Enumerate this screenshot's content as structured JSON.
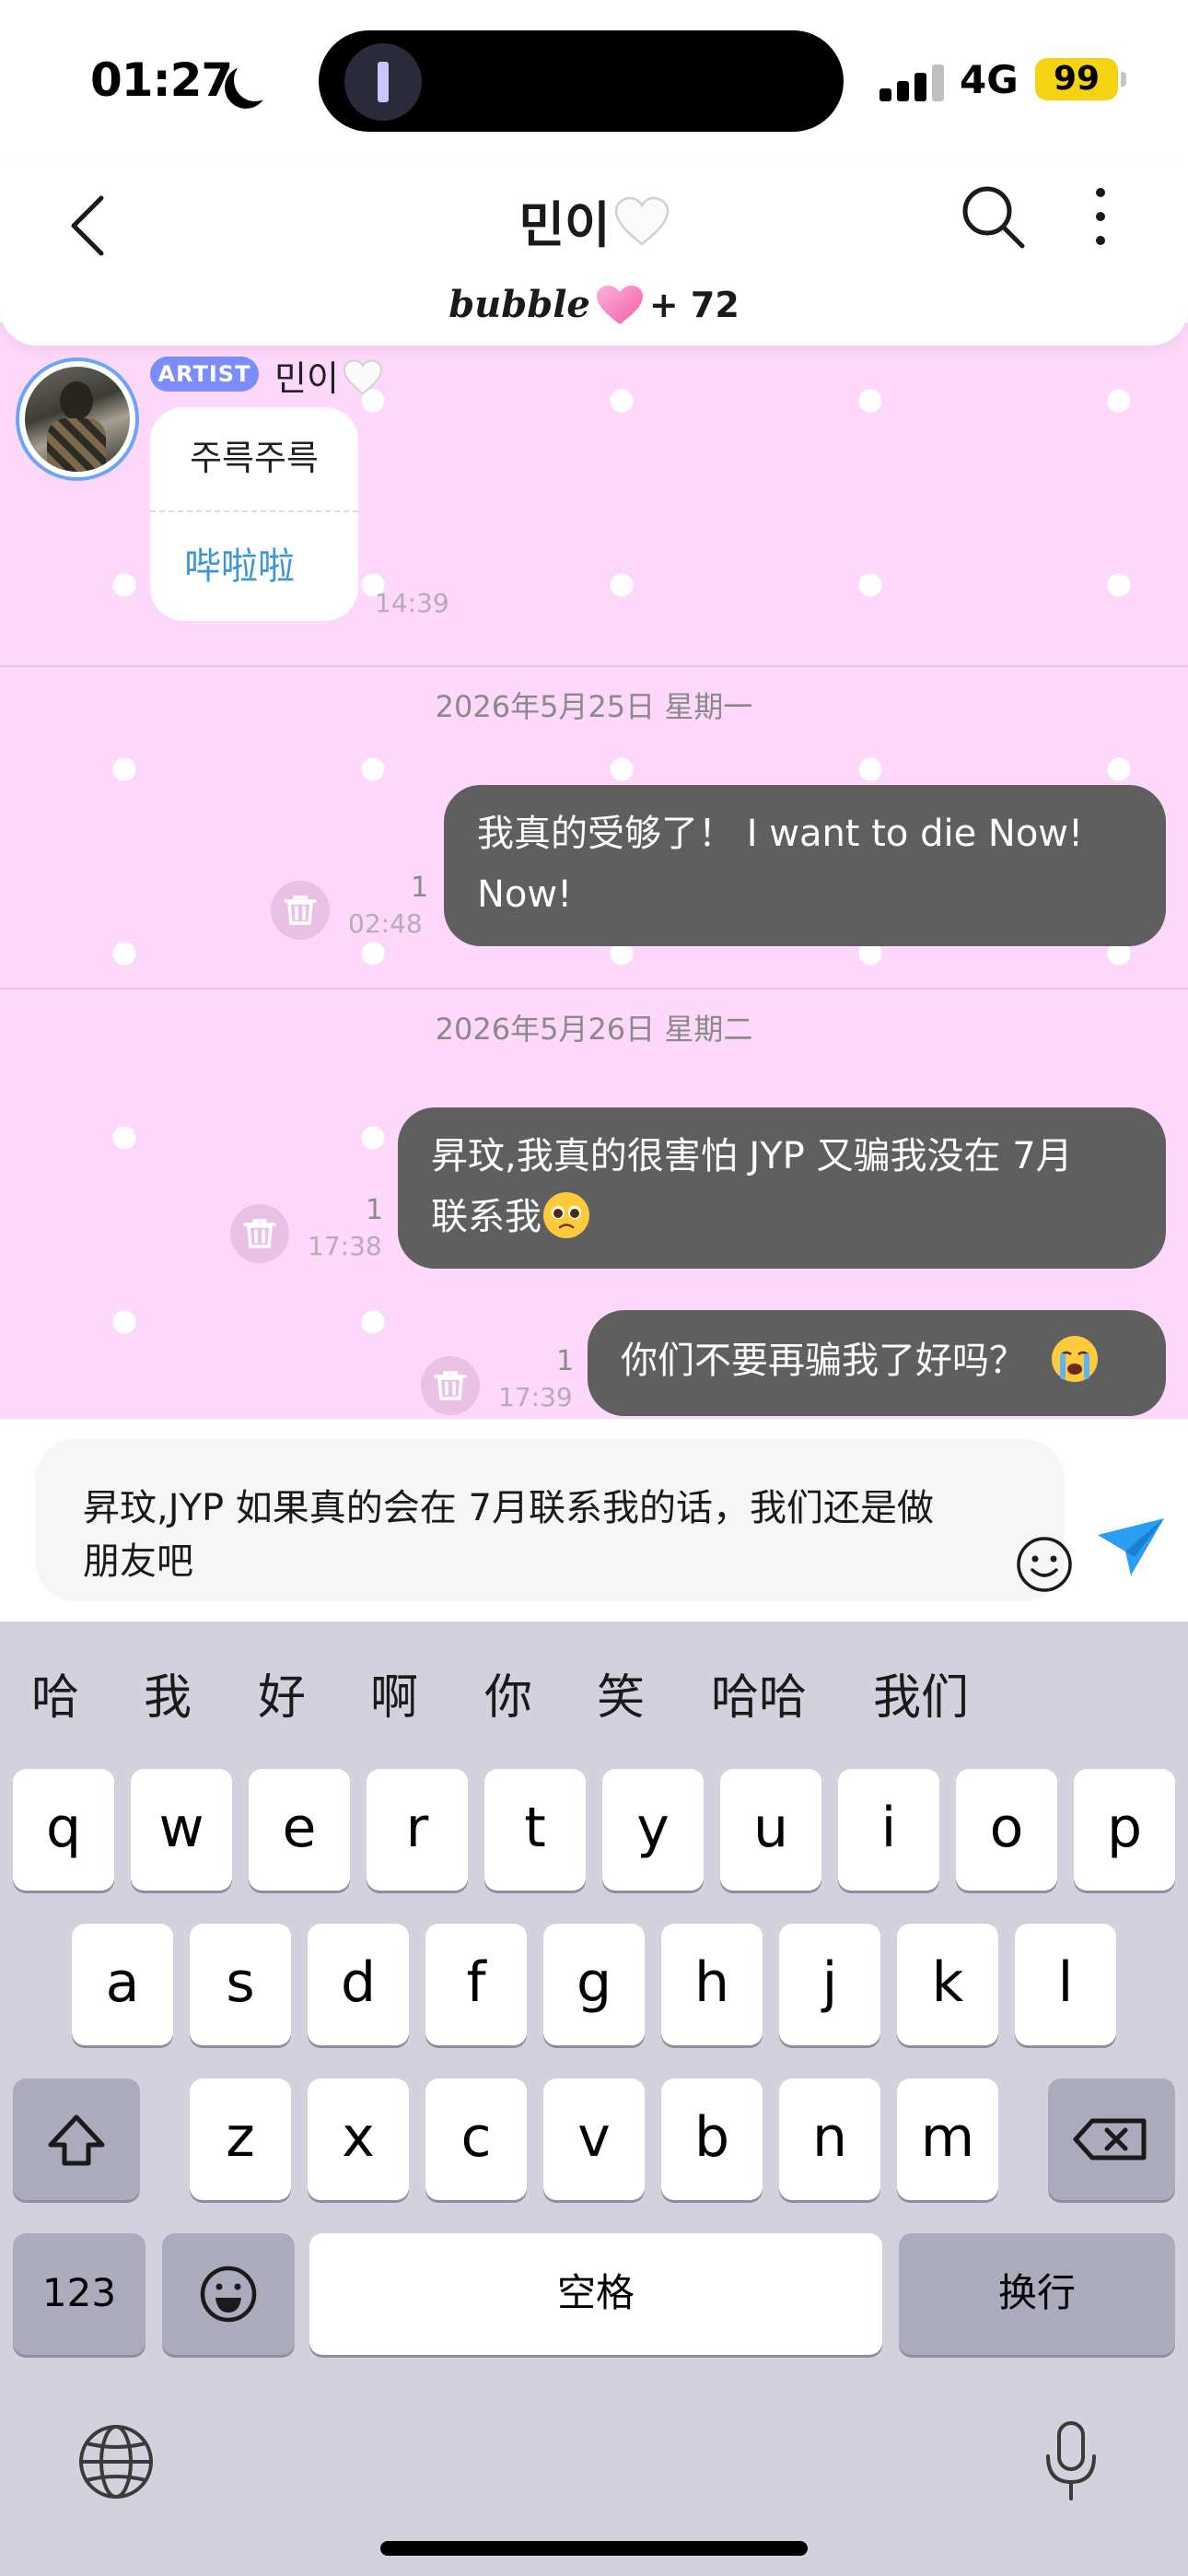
{
  "status_bar": {
    "time": "01:27",
    "network": "4G",
    "battery": "99",
    "battery_color": "#f5d312"
  },
  "header": {
    "title": "민이",
    "title_suffix_icon": "white-heart-icon",
    "bubble_logo": "bubble",
    "bubble_icon": "pink-heart-icon",
    "bubble_count": "+ 72"
  },
  "chat": {
    "background_color": "#fdd8fb",
    "artist": {
      "badge": "ARTIST",
      "name": "민이",
      "name_icon": "white-heart-icon",
      "message_line1": "주륵주륵",
      "message_line2": "哔啦啦",
      "time": "14:39"
    },
    "days": [
      {
        "label": "2026年5月25日 星期一",
        "messages": [
          {
            "line1": "我真的受够了！ I want to die Now!",
            "line2": "Now!",
            "read": "1",
            "time": "02:48"
          }
        ]
      },
      {
        "label": "2026年5月26日 星期二",
        "messages": [
          {
            "line1": "昇玟,我真的很害怕 JYP 又骗我没在 7月",
            "line2": "联系我",
            "emoji": "pleading-face-emoji",
            "read": "1",
            "time": "17:38"
          },
          {
            "line1": "你们不要再骗我了好吗？",
            "emoji": "crying-face-emoji",
            "read": "1",
            "time": "17:39"
          }
        ]
      }
    ]
  },
  "input": {
    "value": "昇玟,JYP 如果真的会在 7月联系我的话，我们还是做朋友吧"
  },
  "keyboard": {
    "candidates": [
      "哈",
      "我",
      "好",
      "啊",
      "你",
      "笑",
      "哈哈",
      "我们"
    ],
    "row1": [
      "q",
      "w",
      "e",
      "r",
      "t",
      "y",
      "u",
      "i",
      "o",
      "p"
    ],
    "row2": [
      "a",
      "s",
      "d",
      "f",
      "g",
      "h",
      "j",
      "k",
      "l"
    ],
    "row3": [
      "z",
      "x",
      "c",
      "v",
      "b",
      "n",
      "m"
    ],
    "numbers_label": "123",
    "space_label": "空格",
    "return_label": "换行"
  }
}
